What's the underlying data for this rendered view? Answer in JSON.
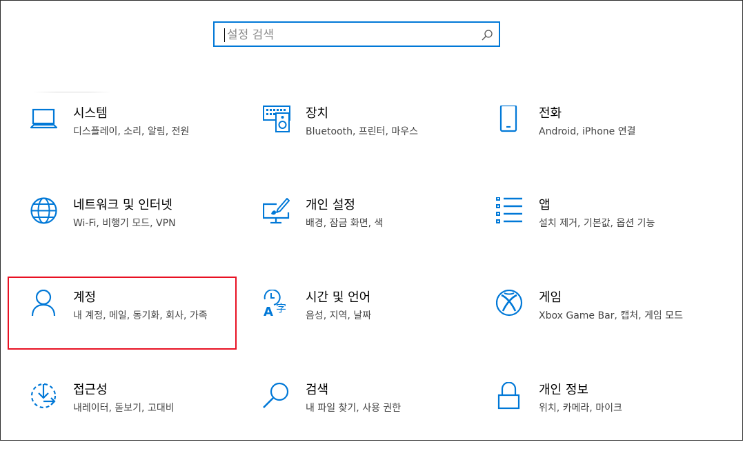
{
  "search": {
    "placeholder": "설정 검색"
  },
  "tiles": [
    {
      "title": "시스템",
      "desc": "디스플레이, 소리, 알림, 전원",
      "icon": "laptop-icon"
    },
    {
      "title": "장치",
      "desc": "Bluetooth, 프린터, 마우스",
      "icon": "devices-icon"
    },
    {
      "title": "전화",
      "desc": "Android, iPhone 연결",
      "icon": "phone-icon"
    },
    {
      "title": "네트워크 및 인터넷",
      "desc": "Wi-Fi, 비행기 모드, VPN",
      "icon": "globe-icon"
    },
    {
      "title": "개인 설정",
      "desc": "배경, 잠금 화면, 색",
      "icon": "personalization-icon"
    },
    {
      "title": "앱",
      "desc": "설치 제거, 기본값, 옵션 기능",
      "icon": "apps-list-icon"
    },
    {
      "title": "계정",
      "desc": "내 계정, 메일, 동기화, 회사, 가족",
      "icon": "person-icon"
    },
    {
      "title": "시간 및 언어",
      "desc": "음성, 지역, 날짜",
      "icon": "time-language-icon"
    },
    {
      "title": "게임",
      "desc": "Xbox Game Bar, 캡처, 게임 모드",
      "icon": "xbox-icon"
    },
    {
      "title": "접근성",
      "desc": "내레이터, 돋보기, 고대비",
      "icon": "ease-of-access-icon"
    },
    {
      "title": "검색",
      "desc": "내 파일 찾기, 사용 권한",
      "icon": "search-magnifier-icon"
    },
    {
      "title": "개인 정보",
      "desc": "위치, 카메라, 마이크",
      "icon": "lock-icon"
    }
  ],
  "colors": {
    "accent": "#0078d7",
    "highlight": "#e81123"
  }
}
